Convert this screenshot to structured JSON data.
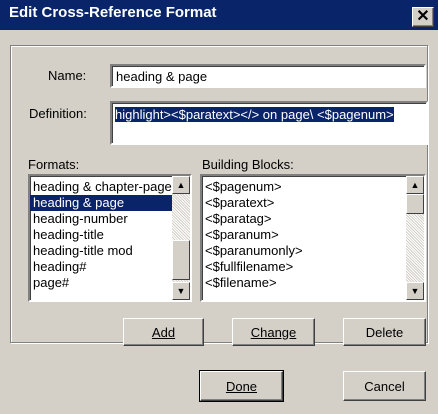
{
  "window": {
    "title": "Edit Cross-Reference Format",
    "close_symbol": "✕"
  },
  "name_label": "Name:",
  "name_value": "heading & page",
  "definition_label": "Definition:",
  "definition_value": "highlight><$paratext></> on page\\ <$pagenum>",
  "formats": {
    "label": "Formats:",
    "items": [
      "heading & chapter-page",
      "heading & page",
      "heading-number",
      "heading-title",
      "heading-title mod",
      "heading#",
      "page#"
    ],
    "selected_index": 1
  },
  "building_blocks": {
    "label": "Building Blocks:",
    "items": [
      "<$pagenum>",
      "<$paratext>",
      "<$paratag>",
      "<$paranum>",
      "<$paranumonly>",
      "<$fullfilename>",
      "<$filename>"
    ]
  },
  "buttons": {
    "add": "Add",
    "change": "Change",
    "delete": "Delete",
    "done": "Done",
    "cancel": "Cancel"
  },
  "colors": {
    "titlebar": "#0a246a",
    "selection": "#0a246a",
    "face": "#d4d0c8"
  }
}
